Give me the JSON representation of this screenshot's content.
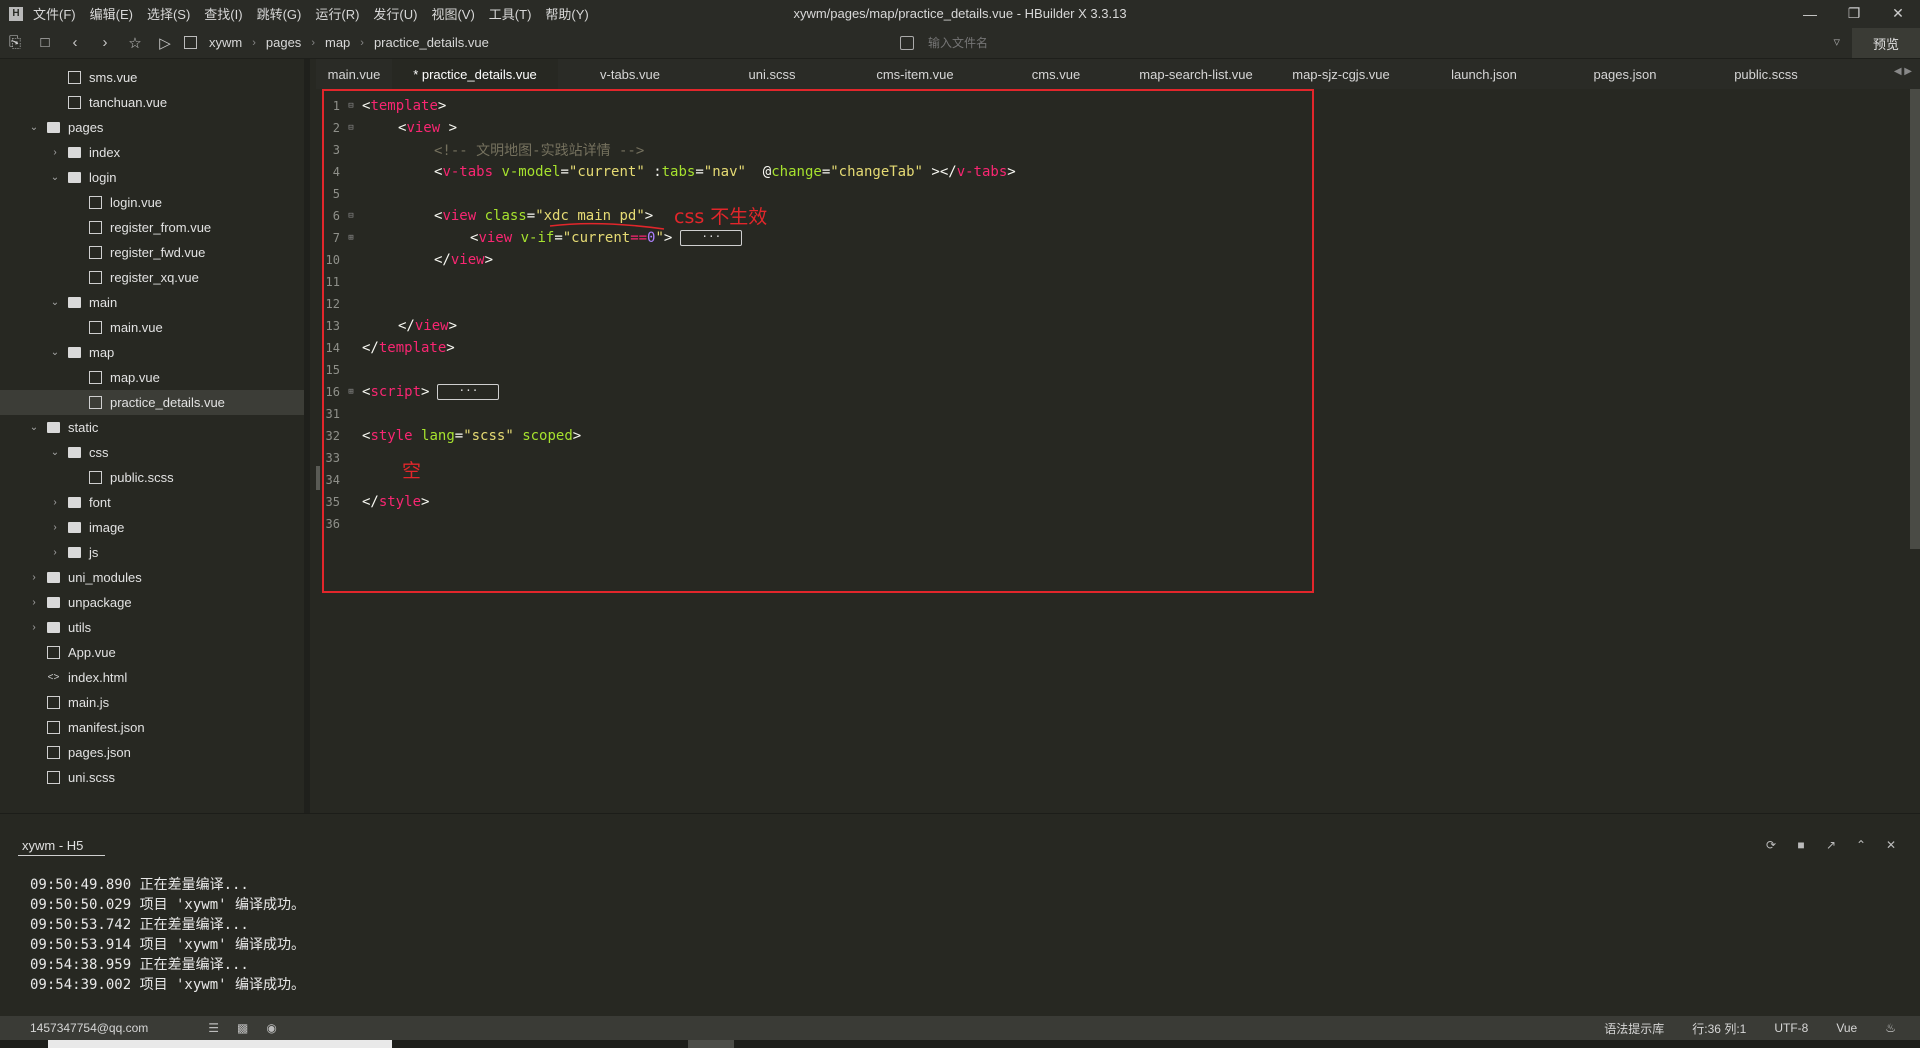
{
  "app": {
    "logo": "H",
    "title": "xywm/pages/map/practice_details.vue - HBuilder X 3.3.13",
    "menu": [
      "文件(F)",
      "编辑(E)",
      "选择(S)",
      "查找(I)",
      "跳转(G)",
      "运行(R)",
      "发行(U)",
      "视图(V)",
      "工具(T)",
      "帮助(Y)"
    ],
    "window_controls": [
      "minimize-icon",
      "restore-icon",
      "close-icon"
    ]
  },
  "toolbar": {
    "breadcrumb": [
      "xywm",
      "pages",
      "map",
      "practice_details.vue"
    ],
    "file_search_placeholder": "输入文件名",
    "preview_label": "预览"
  },
  "sidebar": {
    "items": [
      {
        "label": "sms.vue",
        "type": "file",
        "depth": 2
      },
      {
        "label": "tanchuan.vue",
        "type": "file",
        "depth": 2
      },
      {
        "label": "pages",
        "type": "folder",
        "depth": 1,
        "expanded": true
      },
      {
        "label": "index",
        "type": "folder",
        "depth": 2,
        "expanded": false
      },
      {
        "label": "login",
        "type": "folder",
        "depth": 2,
        "expanded": true
      },
      {
        "label": "login.vue",
        "type": "file",
        "depth": 3
      },
      {
        "label": "register_from.vue",
        "type": "file",
        "depth": 3
      },
      {
        "label": "register_fwd.vue",
        "type": "file",
        "depth": 3
      },
      {
        "label": "register_xq.vue",
        "type": "file",
        "depth": 3
      },
      {
        "label": "main",
        "type": "folder",
        "depth": 2,
        "expanded": true
      },
      {
        "label": "main.vue",
        "type": "file",
        "depth": 3
      },
      {
        "label": "map",
        "type": "folder",
        "depth": 2,
        "expanded": true
      },
      {
        "label": "map.vue",
        "type": "file",
        "depth": 3
      },
      {
        "label": "practice_details.vue",
        "type": "file",
        "depth": 3,
        "selected": true
      },
      {
        "label": "static",
        "type": "folder",
        "depth": 1,
        "expanded": true
      },
      {
        "label": "css",
        "type": "folder",
        "depth": 2,
        "expanded": true
      },
      {
        "label": "public.scss",
        "type": "file",
        "depth": 3
      },
      {
        "label": "font",
        "type": "folder",
        "depth": 2,
        "expanded": false
      },
      {
        "label": "image",
        "type": "folder",
        "depth": 2,
        "expanded": false
      },
      {
        "label": "js",
        "type": "folder",
        "depth": 2,
        "expanded": false
      },
      {
        "label": "uni_modules",
        "type": "folder",
        "depth": 1,
        "expanded": false
      },
      {
        "label": "unpackage",
        "type": "folder",
        "depth": 1,
        "expanded": false
      },
      {
        "label": "utils",
        "type": "folder",
        "depth": 1,
        "expanded": false
      },
      {
        "label": "App.vue",
        "type": "file",
        "depth": 1
      },
      {
        "label": "index.html",
        "type": "file",
        "depth": 1
      },
      {
        "label": "main.js",
        "type": "file",
        "depth": 1
      },
      {
        "label": "manifest.json",
        "type": "file",
        "depth": 1
      },
      {
        "label": "pages.json",
        "type": "file",
        "depth": 1
      },
      {
        "label": "uni.scss",
        "type": "file",
        "depth": 1
      }
    ]
  },
  "tabs": [
    {
      "label": "main.vue",
      "active": false
    },
    {
      "label": "* practice_details.vue",
      "active": true
    },
    {
      "label": "v-tabs.vue",
      "active": false
    },
    {
      "label": "uni.scss",
      "active": false
    },
    {
      "label": "cms-item.vue",
      "active": false
    },
    {
      "label": "cms.vue",
      "active": false
    },
    {
      "label": "map-search-list.vue",
      "active": false
    },
    {
      "label": "map-sjz-cgjs.vue",
      "active": false
    },
    {
      "label": "launch.json",
      "active": false
    },
    {
      "label": "pages.json",
      "active": false
    },
    {
      "label": "public.scss",
      "active": false
    }
  ],
  "editor": {
    "lines": [
      {
        "n": "1",
        "fold": "⊟",
        "indent": 0,
        "tokens": [
          [
            "p",
            "<"
          ],
          [
            "tag",
            "template"
          ],
          [
            "p",
            ">"
          ]
        ]
      },
      {
        "n": "2",
        "fold": "⊟",
        "indent": 1,
        "tokens": [
          [
            "p",
            "<"
          ],
          [
            "tag",
            "view"
          ],
          [
            "p",
            " >"
          ]
        ]
      },
      {
        "n": "3",
        "fold": "",
        "indent": 2,
        "tokens": [
          [
            "cm",
            "<!-- 文明地图-实践站详情 -->"
          ]
        ]
      },
      {
        "n": "4",
        "fold": "",
        "indent": 2,
        "tokens": [
          [
            "p",
            "<"
          ],
          [
            "tag",
            "v-tabs"
          ],
          [
            "p",
            " "
          ],
          [
            "attr",
            "v-model"
          ],
          [
            "p",
            "="
          ],
          [
            "str",
            "\"current\""
          ],
          [
            "p",
            " :"
          ],
          [
            "attr",
            "tabs"
          ],
          [
            "p",
            "="
          ],
          [
            "str",
            "\"nav\""
          ],
          [
            "p",
            "  @"
          ],
          [
            "attr",
            "change"
          ],
          [
            "p",
            "="
          ],
          [
            "str",
            "\"changeTab\""
          ],
          [
            "p",
            " ></"
          ],
          [
            "tag",
            "v-tabs"
          ],
          [
            "p",
            ">"
          ]
        ]
      },
      {
        "n": "5",
        "fold": "",
        "indent": 0,
        "tokens": []
      },
      {
        "n": "6",
        "fold": "⊟",
        "indent": 2,
        "tokens": [
          [
            "p",
            "<"
          ],
          [
            "tag",
            "view"
          ],
          [
            "p",
            " "
          ],
          [
            "attr",
            "class"
          ],
          [
            "p",
            "="
          ],
          [
            "str",
            "\"xdc main pd\""
          ],
          [
            "p",
            ">"
          ]
        ]
      },
      {
        "n": "7",
        "fold": "⊞",
        "indent": 3,
        "tokens": [
          [
            "p",
            "<"
          ],
          [
            "tag",
            "view"
          ],
          [
            "p",
            " "
          ],
          [
            "attr",
            "v-if"
          ],
          [
            "p",
            "="
          ],
          [
            "str",
            "\"current"
          ],
          [
            "op",
            "=="
          ],
          [
            "num",
            "0"
          ],
          [
            "str",
            "\""
          ],
          [
            "p",
            ">"
          ]
        ],
        "collapsed": "···"
      },
      {
        "n": "10",
        "fold": "",
        "indent": 2,
        "tokens": [
          [
            "p",
            "</"
          ],
          [
            "tag",
            "view"
          ],
          [
            "p",
            ">"
          ]
        ]
      },
      {
        "n": "11",
        "fold": "",
        "indent": 0,
        "tokens": []
      },
      {
        "n": "12",
        "fold": "",
        "indent": 0,
        "tokens": []
      },
      {
        "n": "13",
        "fold": "",
        "indent": 1,
        "tokens": [
          [
            "p",
            "</"
          ],
          [
            "tag",
            "view"
          ],
          [
            "p",
            ">"
          ]
        ]
      },
      {
        "n": "14",
        "fold": "",
        "indent": 0,
        "tokens": [
          [
            "p",
            "</"
          ],
          [
            "tag",
            "template"
          ],
          [
            "p",
            ">"
          ]
        ]
      },
      {
        "n": "15",
        "fold": "",
        "indent": 0,
        "tokens": []
      },
      {
        "n": "16",
        "fold": "⊞",
        "indent": 0,
        "tokens": [
          [
            "p",
            "<"
          ],
          [
            "tag",
            "script"
          ],
          [
            "p",
            ">"
          ]
        ],
        "collapsed": "···"
      },
      {
        "n": "31",
        "fold": "",
        "indent": 0,
        "tokens": []
      },
      {
        "n": "32",
        "fold": "",
        "indent": 0,
        "tokens": [
          [
            "p",
            "<"
          ],
          [
            "tag",
            "style"
          ],
          [
            "p",
            " "
          ],
          [
            "attr",
            "lang"
          ],
          [
            "p",
            "="
          ],
          [
            "str",
            "\"scss\""
          ],
          [
            "p",
            " "
          ],
          [
            "attr",
            "scoped"
          ],
          [
            "p",
            ">"
          ]
        ]
      },
      {
        "n": "33",
        "fold": "",
        "indent": 0,
        "tokens": []
      },
      {
        "n": "34",
        "fold": "",
        "indent": 0,
        "tokens": []
      },
      {
        "n": "35",
        "fold": "",
        "indent": 0,
        "tokens": [
          [
            "p",
            "</"
          ],
          [
            "tag",
            "style"
          ],
          [
            "p",
            ">"
          ]
        ]
      },
      {
        "n": "36",
        "fold": "",
        "indent": 0,
        "tokens": []
      }
    ],
    "annotations": {
      "css_not_working": "css 不生效",
      "empty": "空"
    },
    "annotation_color": "#e2262b"
  },
  "console": {
    "tab_label": "xywm - H5",
    "controls": [
      "restart-icon",
      "stop-icon",
      "open-external-icon",
      "collapse-up-icon",
      "close-console-icon"
    ],
    "logs": [
      "09:50:49.890 正在差量编译...",
      "09:50:50.029 项目 'xywm' 编译成功。",
      "09:50:53.742 正在差量编译...",
      "09:50:53.914 项目 'xywm' 编译成功。",
      "09:54:38.959 正在差量编译...",
      "09:54:39.002 项目 'xywm' 编译成功。"
    ]
  },
  "statusbar": {
    "user": "1457347754@qq.com",
    "syntax": "语法提示库",
    "position": "行:36  列:1",
    "encoding": "UTF-8",
    "language": "Vue"
  }
}
